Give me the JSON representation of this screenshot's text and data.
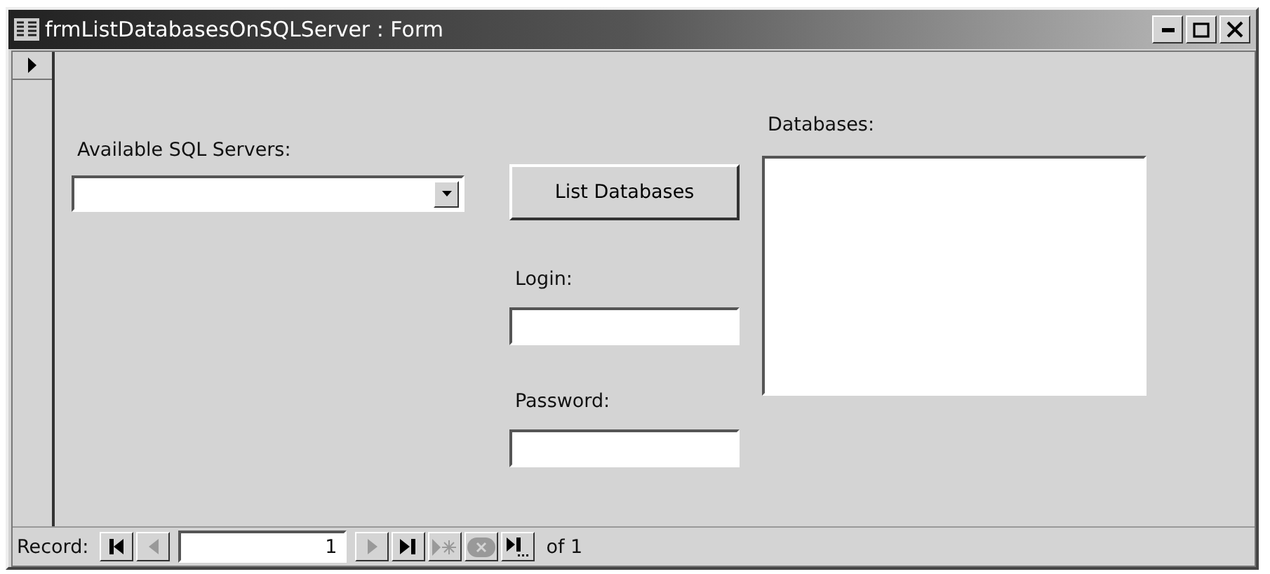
{
  "window": {
    "title": "frmListDatabasesOnSQLServer : Form"
  },
  "servers": {
    "label": "Available SQL Servers:"
  },
  "list_button": {
    "label": "List Databases"
  },
  "login": {
    "label": "Login:"
  },
  "password": {
    "label": "Password:"
  },
  "databases": {
    "label": "Databases:"
  },
  "navigation": {
    "label": "Record:",
    "current": "1",
    "total": "of 1",
    "buttons": [
      {
        "kind": "first",
        "disabled": false
      },
      {
        "kind": "prev",
        "disabled": true
      },
      {
        "kind": "field"
      },
      {
        "kind": "next",
        "disabled": true
      },
      {
        "kind": "last",
        "disabled": false
      },
      {
        "kind": "new",
        "disabled": true
      },
      {
        "kind": "delete",
        "disabled": true
      },
      {
        "kind": "more",
        "disabled": false
      }
    ]
  }
}
